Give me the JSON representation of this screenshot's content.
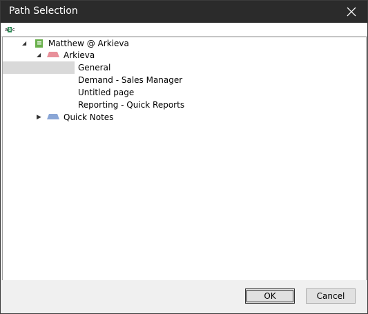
{
  "dialog": {
    "title": "Path Selection"
  },
  "search": {
    "icon_label": "abc-search-icon",
    "placeholder": ""
  },
  "tree": {
    "root": {
      "label": "Matthew @ Arkieva"
    },
    "notebook": {
      "label": "Arkieva"
    },
    "pages": [
      {
        "label": "General"
      },
      {
        "label": "Demand - Sales Manager"
      },
      {
        "label": "Untitled page"
      },
      {
        "label": "Reporting - Quick Reports"
      }
    ],
    "notebook2": {
      "label": "Quick Notes"
    }
  },
  "buttons": {
    "ok": "OK",
    "cancel": "Cancel"
  },
  "colors": {
    "titlebar": "#2b2b2b",
    "selection": "#d9d9d9",
    "arkieva_tab": "#e8909a",
    "quicknotes_tab": "#8aa6d6",
    "account_icon": "#6ab04c"
  }
}
